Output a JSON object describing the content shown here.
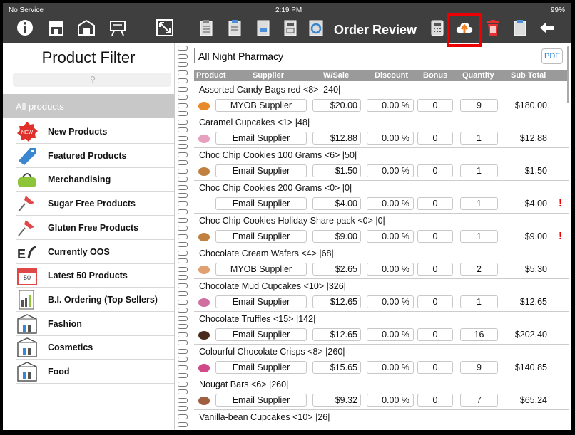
{
  "status": {
    "carrier": "No Service",
    "time": "2:19 PM",
    "battery": "99%"
  },
  "toolbar": {
    "title": "Order Review"
  },
  "filter": {
    "title": "Product Filter",
    "search_placeholder": "",
    "all_label": "All products",
    "categories": [
      {
        "label": "New Products",
        "icon": "new-badge-icon"
      },
      {
        "label": "Featured Products",
        "icon": "tag-icon"
      },
      {
        "label": "Merchandising",
        "icon": "bag-icon"
      },
      {
        "label": "Sugar Free Products",
        "icon": "pin-icon"
      },
      {
        "label": "Gluten Free Products",
        "icon": "pin-icon"
      },
      {
        "label": "Currently OOS",
        "icon": "oos-icon"
      },
      {
        "label": "Latest 50 Products",
        "icon": "calendar-icon"
      },
      {
        "label": "B.I. Ordering (Top Sellers)",
        "icon": "chart-icon"
      },
      {
        "label": "Fashion",
        "icon": "box-icon"
      },
      {
        "label": "Cosmetics",
        "icon": "box-icon"
      },
      {
        "label": "Food",
        "icon": "box-icon"
      }
    ]
  },
  "order": {
    "customer": "All Night Pharmacy",
    "pdf_label": "PDF",
    "columns": [
      "Product",
      "Supplier",
      "W/Sale",
      "Discount",
      "Bonus",
      "Quantity",
      "Sub Total"
    ],
    "rows": [
      {
        "name": "Assorted Candy Bags red <8> |240|",
        "supplier": "MYOB Supplier",
        "price": "$20.00",
        "discount": "0.00 %",
        "bonus": "0",
        "qty": "9",
        "subtotal": "$180.00",
        "thumb": "#e98a2a",
        "warn": ""
      },
      {
        "name": "Caramel Cupcakes <1> |48|",
        "supplier": "Email Supplier",
        "price": "$12.88",
        "discount": "0.00 %",
        "bonus": "0",
        "qty": "1",
        "subtotal": "$12.88",
        "thumb": "#e8a0c0",
        "warn": ""
      },
      {
        "name": "Choc Chip Cookies 100 Grams <6> |50|",
        "supplier": "Email Supplier",
        "price": "$1.50",
        "discount": "0.00 %",
        "bonus": "0",
        "qty": "1",
        "subtotal": "$1.50",
        "thumb": "#c08040",
        "warn": ""
      },
      {
        "name": "Choc Chip Cookies 200 Grams <0> |0|",
        "supplier": "Email Supplier",
        "price": "$4.00",
        "discount": "0.00 %",
        "bonus": "0",
        "qty": "1",
        "subtotal": "$4.00",
        "thumb": "",
        "warn": "!"
      },
      {
        "name": "Choc Chip Cookies Holiday Share pack <0> |0|",
        "supplier": "Email Supplier",
        "price": "$9.00",
        "discount": "0.00 %",
        "bonus": "0",
        "qty": "1",
        "subtotal": "$9.00",
        "thumb": "#c08040",
        "warn": "!"
      },
      {
        "name": "Chocolate Cream Wafers <4> |68|",
        "supplier": "MYOB Supplier",
        "price": "$2.65",
        "discount": "0.00 %",
        "bonus": "0",
        "qty": "2",
        "subtotal": "$5.30",
        "thumb": "#e0a070",
        "warn": ""
      },
      {
        "name": "Chocolate Mud Cupcakes  <10> |326|",
        "supplier": "Email Supplier",
        "price": "$12.65",
        "discount": "0.00 %",
        "bonus": "0",
        "qty": "1",
        "subtotal": "$12.65",
        "thumb": "#d070a0",
        "warn": ""
      },
      {
        "name": "Chocolate Truffles <15> |142|",
        "supplier": "Email Supplier",
        "price": "$12.65",
        "discount": "0.00 %",
        "bonus": "0",
        "qty": "16",
        "subtotal": "$202.40",
        "thumb": "#4a2a1a",
        "warn": ""
      },
      {
        "name": "Colourful Chocolate Crisps <8> |260|",
        "supplier": "Email Supplier",
        "price": "$15.65",
        "discount": "0.00 %",
        "bonus": "0",
        "qty": "9",
        "subtotal": "$140.85",
        "thumb": "#d04a8a",
        "warn": ""
      },
      {
        "name": "Nougat Bars <6> |260|",
        "supplier": "Email Supplier",
        "price": "$9.32",
        "discount": "0.00 %",
        "bonus": "0",
        "qty": "7",
        "subtotal": "$65.24",
        "thumb": "#a06040",
        "warn": ""
      },
      {
        "name": "Vanilla-bean Cupcakes <10> |26|",
        "supplier": "",
        "price": "",
        "discount": "",
        "bonus": "",
        "qty": "",
        "subtotal": "",
        "thumb": "",
        "warn": ""
      }
    ]
  },
  "colors": {
    "toolbar": "#3f3f3f",
    "highlight": "#e00000",
    "header": "#9a9a9a",
    "pdf_blue": "#2a7fd4"
  }
}
